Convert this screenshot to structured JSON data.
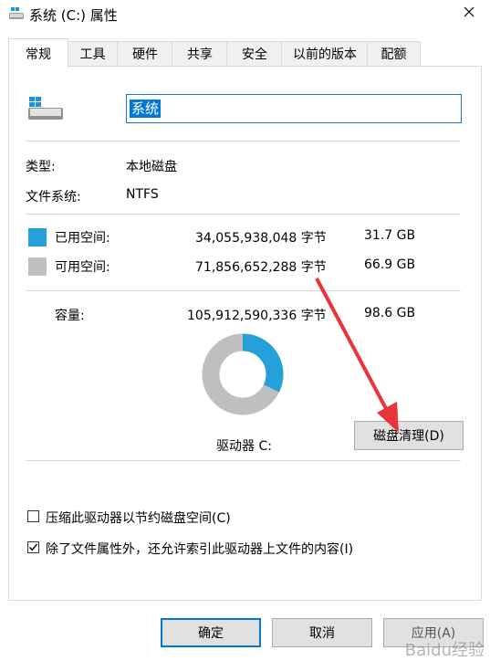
{
  "window": {
    "title": "系统 (C:) 属性"
  },
  "tabs": [
    {
      "label": "常规",
      "active": true
    },
    {
      "label": "工具"
    },
    {
      "label": "硬件"
    },
    {
      "label": "共享"
    },
    {
      "label": "安全"
    },
    {
      "label": "以前的版本"
    },
    {
      "label": "配额"
    }
  ],
  "drive_name": "系统",
  "type": {
    "label": "类型:",
    "value": "本地磁盘"
  },
  "filesystem": {
    "label": "文件系统:",
    "value": "NTFS"
  },
  "used": {
    "label": "已用空间:",
    "bytes": "34,055,938,048 字节",
    "size": "31.7 GB",
    "color": "#26a0da"
  },
  "free": {
    "label": "可用空间:",
    "bytes": "71,856,652,288 字节",
    "size": "66.9 GB",
    "color": "#bfbfbf"
  },
  "capacity": {
    "label": "容量:",
    "bytes": "105,912,590,336 字节",
    "size": "98.6 GB"
  },
  "usage_fraction": 0.322,
  "drive_label": "驱动器 C:",
  "disk_cleanup": "磁盘清理(D)",
  "options": {
    "compress": {
      "label": "压缩此驱动器以节约磁盘空间(C)",
      "checked": false
    },
    "index": {
      "label": "除了文件属性外，还允许索引此驱动器上文件的内容(I)",
      "checked": true
    }
  },
  "buttons": {
    "ok": "确定",
    "cancel": "取消",
    "apply": "应用(A)"
  },
  "watermark": "Baidu经验",
  "annotation_color": "#e8343a"
}
